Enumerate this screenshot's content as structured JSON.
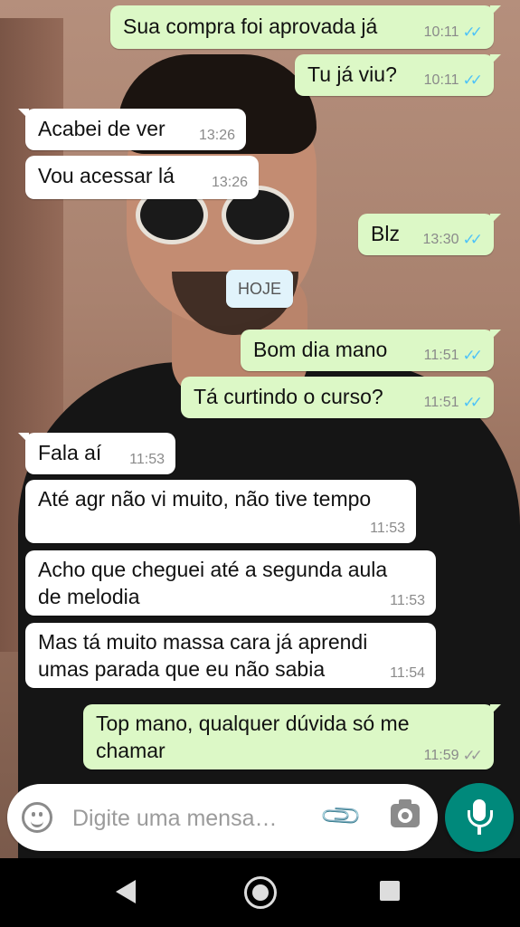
{
  "day_separator": "HOJE",
  "messages": [
    {
      "dir": "out",
      "text": "Sua compra foi aprovada já",
      "time": "10:11",
      "status": "read"
    },
    {
      "dir": "out",
      "text": "Tu já viu?",
      "time": "10:11",
      "status": "read"
    },
    {
      "dir": "in",
      "text": "Acabei de ver",
      "time": "13:26"
    },
    {
      "dir": "in",
      "text": "Vou acessar lá",
      "time": "13:26"
    },
    {
      "dir": "out",
      "text": "Blz",
      "time": "13:30",
      "status": "read"
    },
    {
      "dir": "out",
      "text": "Bom dia mano",
      "time": "11:51",
      "status": "read"
    },
    {
      "dir": "out",
      "text": "Tá curtindo o curso?",
      "time": "11:51",
      "status": "read"
    },
    {
      "dir": "in",
      "text": "Fala aí",
      "time": "11:53"
    },
    {
      "dir": "in",
      "text": "Até agr não vi muito, não tive tempo",
      "time": "11:53"
    },
    {
      "dir": "in",
      "text": "Acho que cheguei até a segunda aula\nde melodia",
      "time": "11:53"
    },
    {
      "dir": "in",
      "text": "Mas tá muito massa cara já aprendi\numas parada que eu não sabia",
      "time": "11:54"
    },
    {
      "dir": "out",
      "text": "Top mano, qualquer dúvida só me\nchamar",
      "time": "11:59",
      "status": "delivered"
    }
  ],
  "composer": {
    "placeholder": "Digite uma mensa…"
  },
  "icons": {
    "read_ticks": "✓✓",
    "delivered_ticks": "✓✓",
    "clip": "📎"
  },
  "colors": {
    "outgoing": "#dcf8c6",
    "incoming": "#ffffff",
    "read_tick": "#4fc3f7",
    "fab": "#00897b"
  }
}
